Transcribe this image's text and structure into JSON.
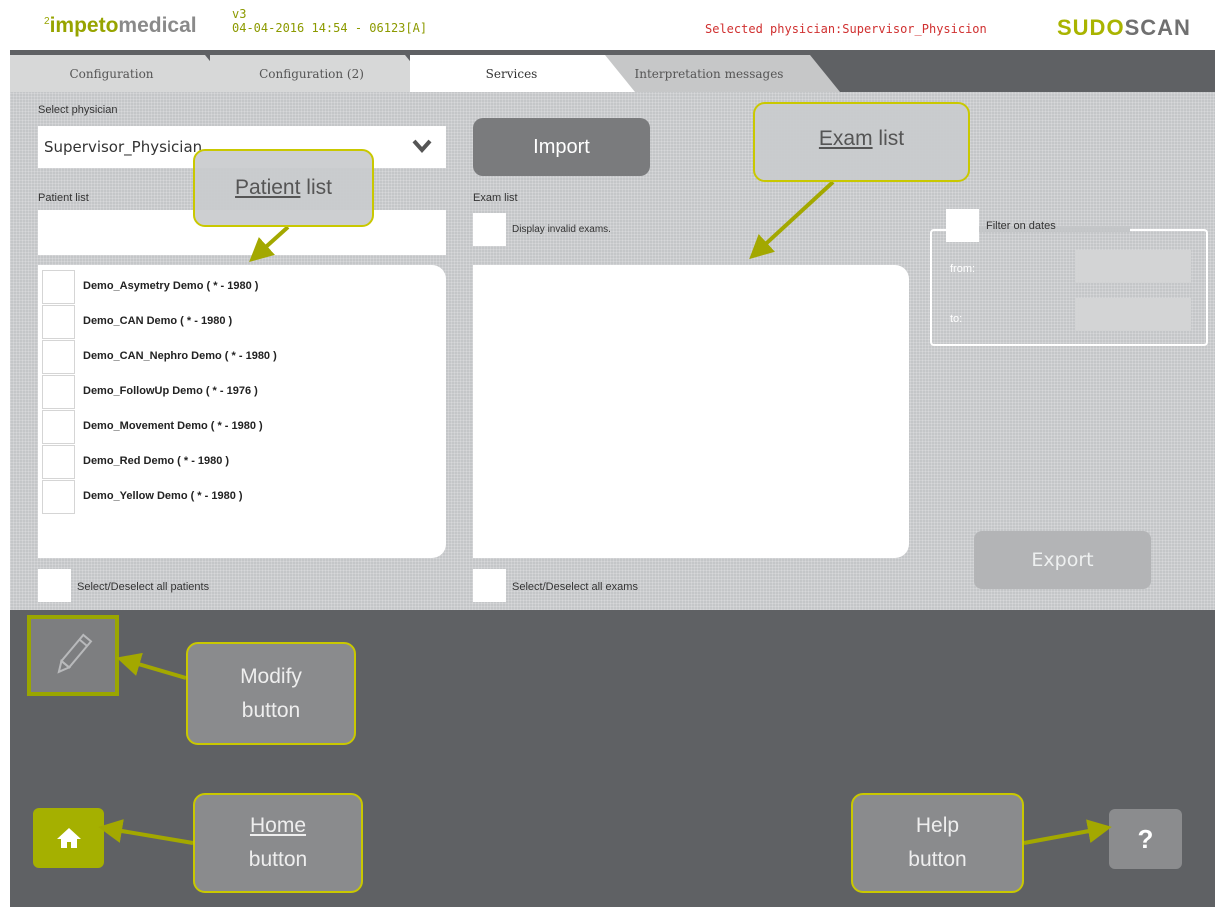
{
  "header": {
    "logo_sup": "2",
    "logo_a": "impeto",
    "logo_b": "medical",
    "version": "v3",
    "build": "04-04-2016 14:54 - 06123[A]",
    "selected_physician": "Selected physician:Supervisor_Physicion",
    "brand_a": "SUDO",
    "brand_b": "SCAN"
  },
  "tabs": [
    {
      "label": "Configuration"
    },
    {
      "label": "Configuration (2)"
    },
    {
      "label": "Services"
    },
    {
      "label": "Interpretation messages"
    }
  ],
  "physician": {
    "label": "Select physician",
    "value": "Supervisor_Physician"
  },
  "import_button": "Import",
  "patients": {
    "label": "Patient list",
    "search_value": "",
    "items": [
      "Demo_Asymetry Demo ( * - 1980 )",
      "Demo_CAN Demo ( * - 1980 )",
      "Demo_CAN_Nephro Demo ( * - 1980 )",
      "Demo_FollowUp Demo ( * - 1976 )",
      "Demo_Movement Demo ( * - 1980 )",
      "Demo_Red Demo ( * - 1980 )",
      "Demo_Yellow Demo ( * - 1980 )"
    ],
    "select_all": "Select/Deselect all patients"
  },
  "exams": {
    "label": "Exam list",
    "display_invalid": "Display invalid exams.",
    "select_all": "Select/Deselect all exams"
  },
  "filter": {
    "label": "Filter on dates",
    "from": "from:",
    "to": "to:"
  },
  "export_button": "Export",
  "help_glyph": "?",
  "callouts": {
    "patient_list_a": "Patient",
    "patient_list_b": " list",
    "exam_list_a": "Exam",
    "exam_list_b": " list",
    "modify_a": "Modify",
    "modify_b": "button",
    "home_a": "Home",
    "home_b": "button",
    "help_a": "Help",
    "help_b": "button"
  },
  "colors": {
    "brand_green": "#a5b000",
    "alert_red": "#d03030",
    "callout_border": "#c9c800"
  },
  "icons": [
    "chevron-down-icon",
    "pencil-icon",
    "home-icon",
    "help-icon"
  ]
}
